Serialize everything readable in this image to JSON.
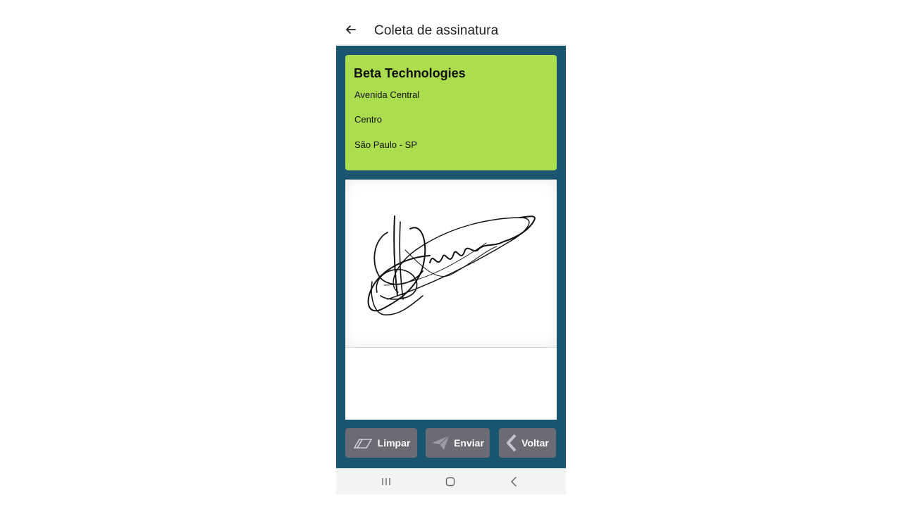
{
  "header": {
    "title": "Coleta de assinatura",
    "back_icon": "arrow-left-icon"
  },
  "company": {
    "name": "Beta Technologies",
    "street": "Avenida Central",
    "district": "Centro",
    "city_state": "São Paulo - SP",
    "card_color": "#acdd4f"
  },
  "signature": {
    "background": "#ffffff"
  },
  "actions": {
    "clear_label": "Limpar",
    "clear_icon": "eraser-icon",
    "send_label": "Enviar",
    "send_icon": "paper-plane-icon",
    "back_label": "Voltar",
    "back_icon": "chevron-left-icon",
    "button_color": "#6b6b73"
  },
  "nav": {
    "recent_icon": "recent-apps-icon",
    "home_icon": "home-icon",
    "back_icon": "back-icon"
  },
  "theme": {
    "primary_background": "#1a5570"
  }
}
